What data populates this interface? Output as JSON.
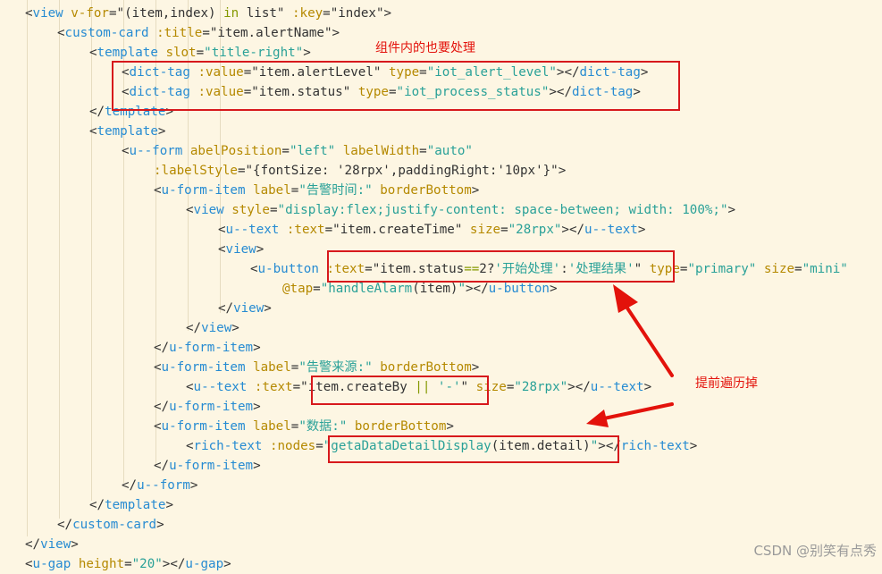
{
  "code_lines": [
    {
      "indent": 0,
      "tokens": [
        [
          "p",
          "<"
        ],
        [
          "t",
          "view"
        ],
        [
          "p",
          " "
        ],
        [
          "a",
          "v-for"
        ],
        [
          "p",
          "=\"(item,index) "
        ],
        [
          "k",
          "in"
        ],
        [
          "p",
          " list\" "
        ],
        [
          "a",
          ":key"
        ],
        [
          "p",
          "=\"index\">"
        ]
      ]
    },
    {
      "indent": 1,
      "tokens": [
        [
          "p",
          "<"
        ],
        [
          "t",
          "custom-card"
        ],
        [
          "p",
          " "
        ],
        [
          "a",
          ":title"
        ],
        [
          "p",
          "=\"item.alertName\">"
        ]
      ]
    },
    {
      "indent": 2,
      "tokens": [
        [
          "p",
          "<"
        ],
        [
          "t",
          "template"
        ],
        [
          "p",
          " "
        ],
        [
          "a",
          "slot"
        ],
        [
          "p",
          "="
        ],
        [
          "s",
          "\"title-right\""
        ],
        [
          "p",
          ">"
        ]
      ]
    },
    {
      "indent": 3,
      "tokens": [
        [
          "p",
          "<"
        ],
        [
          "t",
          "dict-tag"
        ],
        [
          "p",
          " "
        ],
        [
          "a",
          ":value"
        ],
        [
          "p",
          "=\"item.alertLevel\" "
        ],
        [
          "a",
          "type"
        ],
        [
          "p",
          "="
        ],
        [
          "s",
          "\"iot_alert_level\""
        ],
        [
          "p",
          "></"
        ],
        [
          "t",
          "dict-tag"
        ],
        [
          "p",
          ">"
        ]
      ]
    },
    {
      "indent": 3,
      "tokens": [
        [
          "p",
          "<"
        ],
        [
          "t",
          "dict-tag"
        ],
        [
          "p",
          " "
        ],
        [
          "a",
          ":value"
        ],
        [
          "p",
          "=\"item.status\" "
        ],
        [
          "a",
          "type"
        ],
        [
          "p",
          "="
        ],
        [
          "s",
          "\"iot_process_status\""
        ],
        [
          "p",
          "></"
        ],
        [
          "t",
          "dict-tag"
        ],
        [
          "p",
          ">"
        ]
      ]
    },
    {
      "indent": 2,
      "tokens": [
        [
          "p",
          "</"
        ],
        [
          "t",
          "template"
        ],
        [
          "p",
          ">"
        ]
      ]
    },
    {
      "indent": 2,
      "tokens": [
        [
          "p",
          "<"
        ],
        [
          "t",
          "template"
        ],
        [
          "p",
          ">"
        ]
      ]
    },
    {
      "indent": 3,
      "tokens": [
        [
          "p",
          "<"
        ],
        [
          "t",
          "u--form"
        ],
        [
          "p",
          " "
        ],
        [
          "a",
          "abelPosition"
        ],
        [
          "p",
          "="
        ],
        [
          "s",
          "\"left\""
        ],
        [
          "p",
          " "
        ],
        [
          "a",
          "labelWidth"
        ],
        [
          "p",
          "="
        ],
        [
          "s",
          "\"auto\""
        ]
      ]
    },
    {
      "indent": 4,
      "tokens": [
        [
          "a",
          ":labelStyle"
        ],
        [
          "p",
          "=\"{fontSize: '28rpx',paddingRight:'10px'}\">"
        ]
      ]
    },
    {
      "indent": 4,
      "tokens": [
        [
          "p",
          "<"
        ],
        [
          "t",
          "u-form-item"
        ],
        [
          "p",
          " "
        ],
        [
          "a",
          "label"
        ],
        [
          "p",
          "="
        ],
        [
          "s",
          "\"告警时间:\""
        ],
        [
          "p",
          " "
        ],
        [
          "a",
          "borderBottom"
        ],
        [
          "p",
          ">"
        ]
      ]
    },
    {
      "indent": 5,
      "tokens": [
        [
          "p",
          "<"
        ],
        [
          "t",
          "view"
        ],
        [
          "p",
          " "
        ],
        [
          "a",
          "style"
        ],
        [
          "p",
          "="
        ],
        [
          "s",
          "\"display:flex;justify-content: space-between; width: 100%;\""
        ],
        [
          "p",
          ">"
        ]
      ]
    },
    {
      "indent": 6,
      "tokens": [
        [
          "p",
          "<"
        ],
        [
          "t",
          "u--text"
        ],
        [
          "p",
          " "
        ],
        [
          "a",
          ":text"
        ],
        [
          "p",
          "=\"item.createTime\" "
        ],
        [
          "a",
          "size"
        ],
        [
          "p",
          "="
        ],
        [
          "s",
          "\"28rpx\""
        ],
        [
          "p",
          "></"
        ],
        [
          "t",
          "u--text"
        ],
        [
          "p",
          ">"
        ]
      ]
    },
    {
      "indent": 6,
      "tokens": [
        [
          "p",
          "<"
        ],
        [
          "t",
          "view"
        ],
        [
          "p",
          ">"
        ]
      ]
    },
    {
      "indent": 7,
      "tokens": [
        [
          "p",
          "<"
        ],
        [
          "t",
          "u-button"
        ],
        [
          "p",
          " "
        ],
        [
          "a",
          ":text"
        ],
        [
          "p",
          "=\"item.status"
        ],
        [
          "k",
          "=="
        ],
        [
          "p",
          "2?"
        ],
        [
          "s",
          "'开始处理'"
        ],
        [
          "p",
          ":"
        ],
        [
          "s",
          "'处理结果'"
        ],
        [
          "p",
          "\" "
        ],
        [
          "a",
          "type"
        ],
        [
          "p",
          "="
        ],
        [
          "s",
          "\"primary\""
        ],
        [
          "p",
          " "
        ],
        [
          "a",
          "size"
        ],
        [
          "p",
          "="
        ],
        [
          "s",
          "\"mini\""
        ]
      ]
    },
    {
      "indent": 8,
      "tokens": [
        [
          "a",
          "@tap"
        ],
        [
          "p",
          "="
        ],
        [
          "s",
          "\"handleAlarm"
        ],
        [
          "p",
          "(item)"
        ],
        [
          "s",
          "\""
        ],
        [
          "p",
          "></"
        ],
        [
          "t",
          "u-button"
        ],
        [
          "p",
          ">"
        ]
      ]
    },
    {
      "indent": 6,
      "tokens": [
        [
          "p",
          "</"
        ],
        [
          "t",
          "view"
        ],
        [
          "p",
          ">"
        ]
      ]
    },
    {
      "indent": 5,
      "tokens": [
        [
          "p",
          "</"
        ],
        [
          "t",
          "view"
        ],
        [
          "p",
          ">"
        ]
      ]
    },
    {
      "indent": 4,
      "tokens": [
        [
          "p",
          "</"
        ],
        [
          "t",
          "u-form-item"
        ],
        [
          "p",
          ">"
        ]
      ]
    },
    {
      "indent": 4,
      "tokens": [
        [
          "p",
          "<"
        ],
        [
          "t",
          "u-form-item"
        ],
        [
          "p",
          " "
        ],
        [
          "a",
          "label"
        ],
        [
          "p",
          "="
        ],
        [
          "s",
          "\"告警来源:\""
        ],
        [
          "p",
          " "
        ],
        [
          "a",
          "borderBottom"
        ],
        [
          "p",
          ">"
        ]
      ]
    },
    {
      "indent": 5,
      "tokens": [
        [
          "p",
          "<"
        ],
        [
          "t",
          "u--text"
        ],
        [
          "p",
          " "
        ],
        [
          "a",
          ":text"
        ],
        [
          "p",
          "=\"item.createBy "
        ],
        [
          "k",
          "||"
        ],
        [
          "p",
          " "
        ],
        [
          "s",
          "'-'"
        ],
        [
          "p",
          "\" "
        ],
        [
          "a",
          "size"
        ],
        [
          "p",
          "="
        ],
        [
          "s",
          "\"28rpx\""
        ],
        [
          "p",
          "></"
        ],
        [
          "t",
          "u--text"
        ],
        [
          "p",
          ">"
        ]
      ]
    },
    {
      "indent": 4,
      "tokens": [
        [
          "p",
          "</"
        ],
        [
          "t",
          "u-form-item"
        ],
        [
          "p",
          ">"
        ]
      ]
    },
    {
      "indent": 4,
      "tokens": [
        [
          "p",
          "<"
        ],
        [
          "t",
          "u-form-item"
        ],
        [
          "p",
          " "
        ],
        [
          "a",
          "label"
        ],
        [
          "p",
          "="
        ],
        [
          "s",
          "\"数据:\""
        ],
        [
          "p",
          " "
        ],
        [
          "a",
          "borderBottom"
        ],
        [
          "p",
          ">"
        ]
      ]
    },
    {
      "indent": 5,
      "tokens": [
        [
          "p",
          "<"
        ],
        [
          "t",
          "rich-text"
        ],
        [
          "p",
          " "
        ],
        [
          "a",
          ":nodes"
        ],
        [
          "p",
          "="
        ],
        [
          "s",
          "\"getaDataDetailDisplay"
        ],
        [
          "p",
          "(item.detail)"
        ],
        [
          "s",
          "\""
        ],
        [
          "p",
          "></"
        ],
        [
          "t",
          "rich-text"
        ],
        [
          "p",
          ">"
        ]
      ]
    },
    {
      "indent": 4,
      "tokens": [
        [
          "p",
          "</"
        ],
        [
          "t",
          "u-form-item"
        ],
        [
          "p",
          ">"
        ]
      ]
    },
    {
      "indent": 3,
      "tokens": [
        [
          "p",
          "</"
        ],
        [
          "t",
          "u--form"
        ],
        [
          "p",
          ">"
        ]
      ]
    },
    {
      "indent": 2,
      "tokens": [
        [
          "p",
          "</"
        ],
        [
          "t",
          "template"
        ],
        [
          "p",
          ">"
        ]
      ]
    },
    {
      "indent": 1,
      "tokens": [
        [
          "p",
          "</"
        ],
        [
          "t",
          "custom-card"
        ],
        [
          "p",
          ">"
        ]
      ]
    },
    {
      "indent": 0,
      "tokens": [
        [
          "p",
          "</"
        ],
        [
          "t",
          "view"
        ],
        [
          "p",
          ">"
        ]
      ]
    },
    {
      "indent": 0,
      "tokens": [
        [
          "p",
          "<"
        ],
        [
          "t",
          "u-gap"
        ],
        [
          "p",
          " "
        ],
        [
          "a",
          "height"
        ],
        [
          "p",
          "="
        ],
        [
          "s",
          "\"20\""
        ],
        [
          "p",
          "></"
        ],
        [
          "t",
          "u-gap"
        ],
        [
          "p",
          ">"
        ]
      ]
    }
  ],
  "annotations": {
    "note_components": "组件内的也要处理",
    "note_traverse": "提前遍历掉"
  },
  "watermark": "CSDN @别笑有点秀",
  "colors": {
    "background": "#fdf6e3",
    "tag": "#268bd2",
    "attribute": "#b58900",
    "string": "#2aa198",
    "keyword": "#859900",
    "highlight_box": "#d7191c"
  }
}
